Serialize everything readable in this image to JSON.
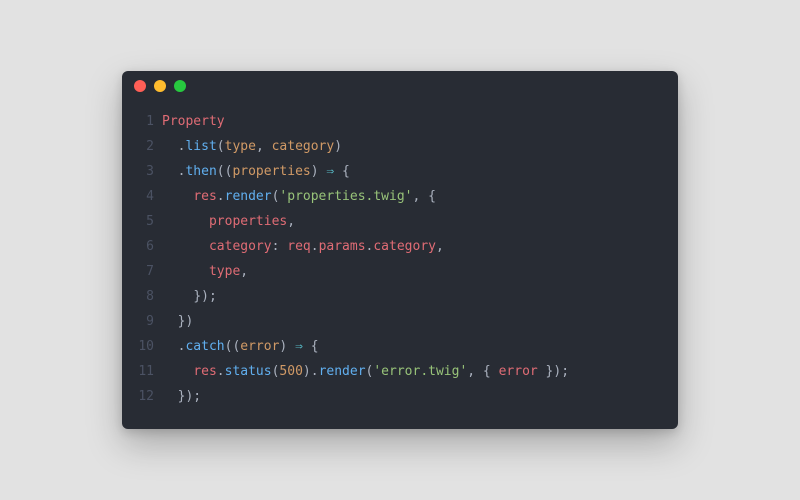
{
  "titlebar": {
    "dots": [
      "red",
      "yellow",
      "green"
    ]
  },
  "colors": {
    "background": "#282c34",
    "gutter": "#4b5263",
    "default": "#abb2bf",
    "red": "#e06c75",
    "orange": "#d19a66",
    "blue": "#61afef",
    "cyan": "#56b6c2",
    "green": "#98c379",
    "purple": "#c678dd"
  },
  "lines": [
    {
      "n": "1",
      "indent": "",
      "tokens": [
        {
          "t": "Property",
          "c": "red"
        }
      ]
    },
    {
      "n": "2",
      "indent": "  ",
      "tokens": [
        {
          "t": ".",
          "c": "gray"
        },
        {
          "t": "list",
          "c": "blue"
        },
        {
          "t": "(",
          "c": "gray"
        },
        {
          "t": "type",
          "c": "orange"
        },
        {
          "t": ", ",
          "c": "gray"
        },
        {
          "t": "category",
          "c": "orange"
        },
        {
          "t": ")",
          "c": "gray"
        }
      ]
    },
    {
      "n": "3",
      "indent": "  ",
      "tokens": [
        {
          "t": ".",
          "c": "gray"
        },
        {
          "t": "then",
          "c": "blue"
        },
        {
          "t": "((",
          "c": "gray"
        },
        {
          "t": "properties",
          "c": "orange"
        },
        {
          "t": ") ",
          "c": "gray"
        },
        {
          "t": "⇒",
          "c": "cyan"
        },
        {
          "t": " {",
          "c": "gray"
        }
      ]
    },
    {
      "n": "4",
      "indent": "    ",
      "tokens": [
        {
          "t": "res",
          "c": "red"
        },
        {
          "t": ".",
          "c": "gray"
        },
        {
          "t": "render",
          "c": "blue"
        },
        {
          "t": "(",
          "c": "gray"
        },
        {
          "t": "'properties.twig'",
          "c": "green"
        },
        {
          "t": ", {",
          "c": "gray"
        }
      ]
    },
    {
      "n": "5",
      "indent": "      ",
      "tokens": [
        {
          "t": "properties",
          "c": "red"
        },
        {
          "t": ",",
          "c": "gray"
        }
      ]
    },
    {
      "n": "6",
      "indent": "      ",
      "tokens": [
        {
          "t": "category",
          "c": "red"
        },
        {
          "t": ": ",
          "c": "gray"
        },
        {
          "t": "req",
          "c": "red"
        },
        {
          "t": ".",
          "c": "gray"
        },
        {
          "t": "params",
          "c": "red"
        },
        {
          "t": ".",
          "c": "gray"
        },
        {
          "t": "category",
          "c": "red"
        },
        {
          "t": ",",
          "c": "gray"
        }
      ]
    },
    {
      "n": "7",
      "indent": "      ",
      "tokens": [
        {
          "t": "type",
          "c": "red"
        },
        {
          "t": ",",
          "c": "gray"
        }
      ]
    },
    {
      "n": "8",
      "indent": "    ",
      "tokens": [
        {
          "t": "});",
          "c": "gray"
        }
      ]
    },
    {
      "n": "9",
      "indent": "  ",
      "tokens": [
        {
          "t": "})",
          "c": "gray"
        }
      ]
    },
    {
      "n": "10",
      "indent": "  ",
      "tokens": [
        {
          "t": ".",
          "c": "gray"
        },
        {
          "t": "catch",
          "c": "blue"
        },
        {
          "t": "((",
          "c": "gray"
        },
        {
          "t": "error",
          "c": "orange"
        },
        {
          "t": ") ",
          "c": "gray"
        },
        {
          "t": "⇒",
          "c": "cyan"
        },
        {
          "t": " {",
          "c": "gray"
        }
      ]
    },
    {
      "n": "11",
      "indent": "    ",
      "tokens": [
        {
          "t": "res",
          "c": "red"
        },
        {
          "t": ".",
          "c": "gray"
        },
        {
          "t": "status",
          "c": "blue"
        },
        {
          "t": "(",
          "c": "gray"
        },
        {
          "t": "500",
          "c": "orange"
        },
        {
          "t": ").",
          "c": "gray"
        },
        {
          "t": "render",
          "c": "blue"
        },
        {
          "t": "(",
          "c": "gray"
        },
        {
          "t": "'error.twig'",
          "c": "green"
        },
        {
          "t": ", { ",
          "c": "gray"
        },
        {
          "t": "error",
          "c": "red"
        },
        {
          "t": " });",
          "c": "gray"
        }
      ]
    },
    {
      "n": "12",
      "indent": "  ",
      "tokens": [
        {
          "t": "});",
          "c": "gray"
        }
      ]
    }
  ]
}
